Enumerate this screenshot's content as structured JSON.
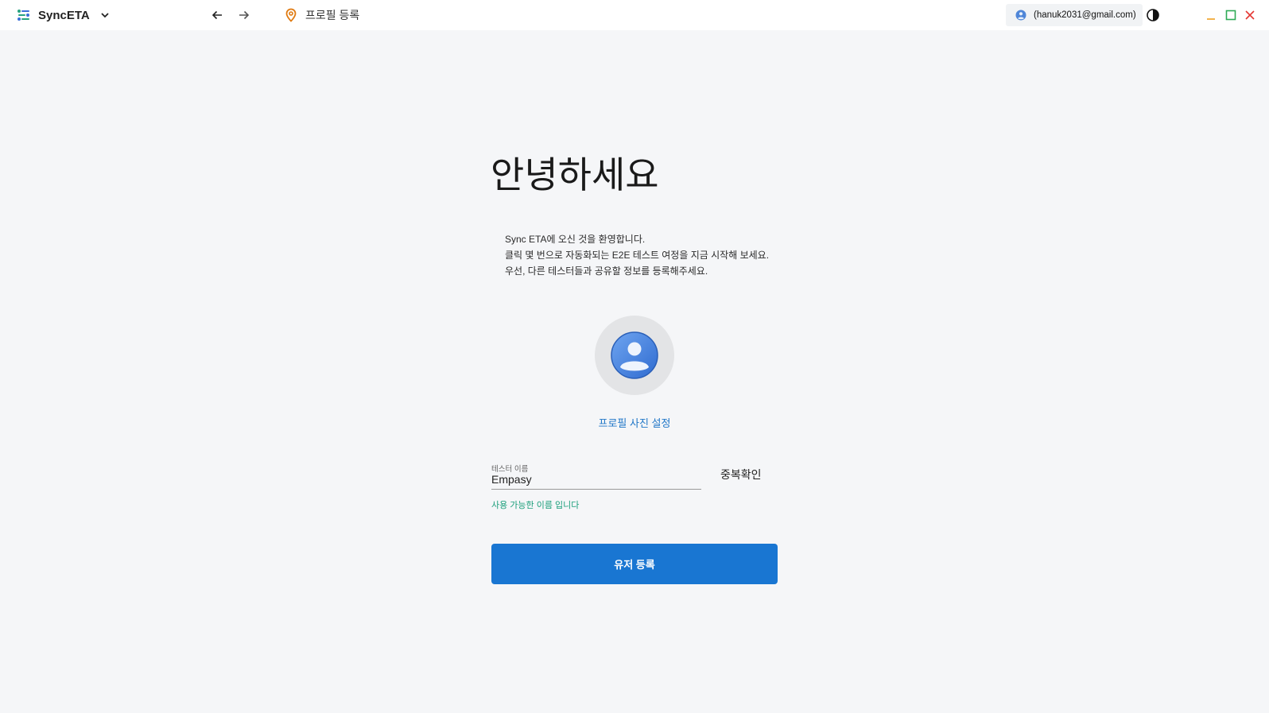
{
  "titlebar": {
    "app_name": "SyncETA",
    "breadcrumb": "프로필 등록",
    "account_email": "(hanuk2031@gmail.com)"
  },
  "main": {
    "greeting": "안녕하세요",
    "welcome_lines": [
      "Sync ETA에 오신 것을 환영합니다.",
      "클릭 몇 번으로 자동화되는 E2E 테스트 여정을 지금 시작해 보세요.",
      "우선, 다른 테스터들과 공유할 정보를 등록해주세요."
    ],
    "photo_link": "프로필 사진 설정",
    "tester_name": {
      "label": "테스터 이름",
      "value": "Empasy",
      "help": "사용 가능한 이름 입니다"
    },
    "dup_check_label": "중복확인",
    "submit_label": "유저 등록"
  },
  "colors": {
    "accent": "#1976d2",
    "success": "#1a9e7a",
    "link": "#1f76c7",
    "background": "#f5f6f8"
  },
  "icons": [
    "app-logo-icon",
    "chevron-down-icon",
    "arrow-left-icon",
    "arrow-right-icon",
    "location-pin-icon",
    "globe-avatar-icon",
    "contrast-icon",
    "minimize-icon",
    "maximize-icon",
    "close-icon",
    "user-avatar-icon"
  ]
}
